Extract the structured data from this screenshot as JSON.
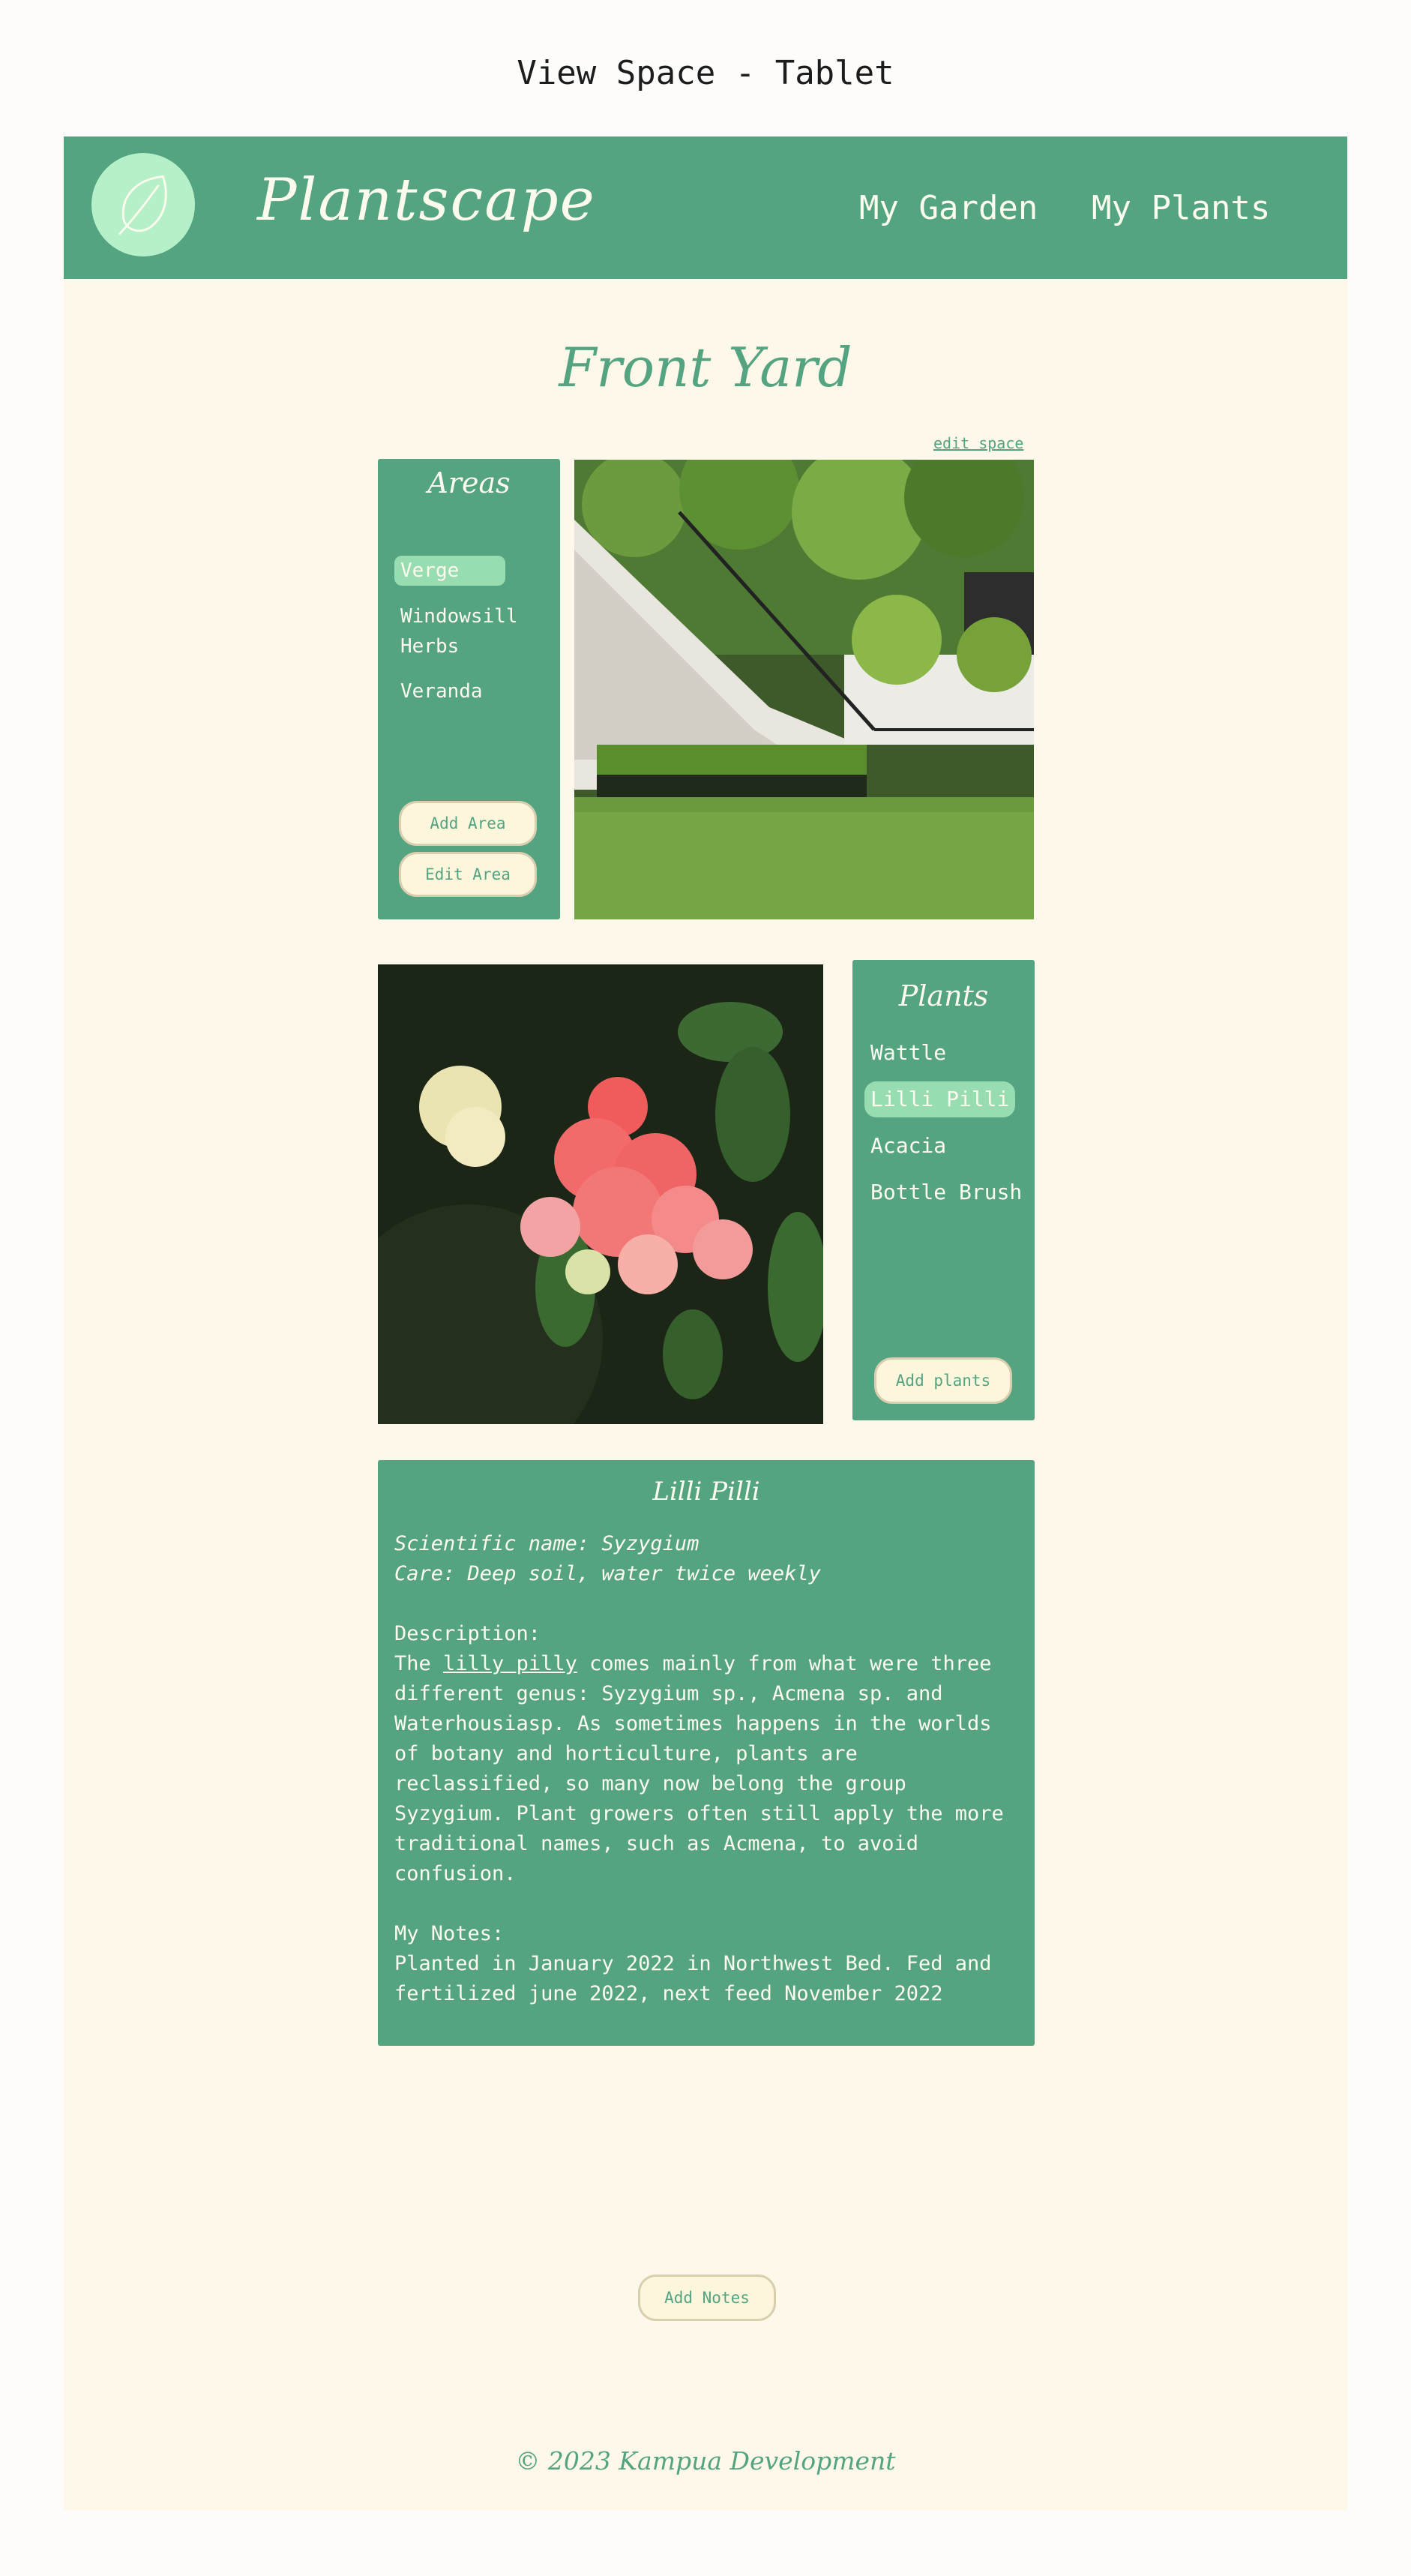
{
  "page": {
    "heading": "View Space - Tablet"
  },
  "header": {
    "logo_icon": "leaf-icon",
    "brand": "Plantscape",
    "nav": [
      "My Garden",
      "My Plants"
    ]
  },
  "space": {
    "title": "Front Yard",
    "edit_link": "edit space"
  },
  "areas": {
    "title": "Areas",
    "items": [
      "Verge",
      "Windowsill Herbs",
      "Veranda"
    ],
    "selected": "Verge",
    "add_button": "Add Area",
    "edit_button": "Edit Area"
  },
  "plants": {
    "title": "Plants",
    "items": [
      "Wattle",
      "Lilli Pilli",
      "Acacia",
      "Bottle Brush"
    ],
    "selected": "Lilli Pilli",
    "add_button": "Add plants"
  },
  "details": {
    "title": "Lilli Pilli",
    "scientific": "Scientific name: Syzygium",
    "care": "Care: Deep soil, water twice weekly",
    "description_label": "Description:",
    "description_prefix": "The ",
    "description_link": "lilly pilly",
    "description_rest": " comes mainly from what were three different genus: Syzygium sp., Acmena sp. and Waterhousiasp. As sometimes happens in the worlds of botany and horticulture, plants are reclassified, so many now belong the group Syzygium. Plant growers often still apply the more traditional names, such as Acmena, to avoid confusion.",
    "notes_label": "My Notes:",
    "notes_text": "Planted in January 2022 in Northwest Bed. Fed and fertilized june 2022, next feed November 2022"
  },
  "add_notes_button": "Add Notes",
  "footer": "© 2023 Kampua Development",
  "colors": {
    "primary": "#54a381",
    "background": "#fdf8ea",
    "highlight": "#98dcb2",
    "logo_bg": "#b6f0c8"
  }
}
